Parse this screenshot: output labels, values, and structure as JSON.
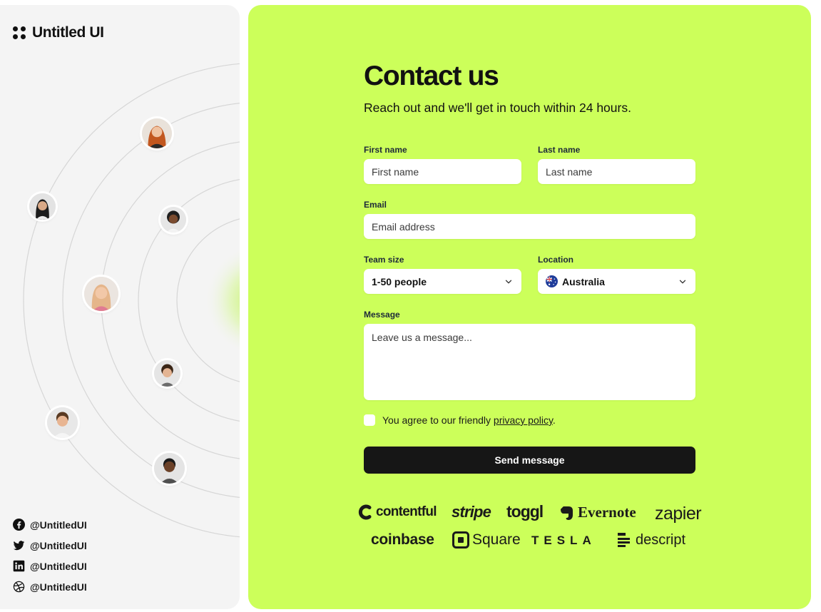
{
  "brand": {
    "name": "Untitled UI"
  },
  "socials": [
    {
      "icon": "facebook-icon",
      "handle": "@UntitledUI"
    },
    {
      "icon": "twitter-icon",
      "handle": "@UntitledUI"
    },
    {
      "icon": "linkedin-icon",
      "handle": "@UntitledUI"
    },
    {
      "icon": "dribbble-icon",
      "handle": "@UntitledUI"
    }
  ],
  "form": {
    "title": "Contact us",
    "subtitle": "Reach out and we'll get in touch within 24 hours.",
    "first_name": {
      "label": "First name",
      "placeholder": "First name"
    },
    "last_name": {
      "label": "Last name",
      "placeholder": "Last name"
    },
    "email": {
      "label": "Email",
      "placeholder": "Email address"
    },
    "team_size": {
      "label": "Team size",
      "value": "1-50 people"
    },
    "location": {
      "label": "Location",
      "value": "Australia",
      "flag_icon": "australia-flag-icon"
    },
    "message": {
      "label": "Message",
      "placeholder": "Leave us a message..."
    },
    "agree": {
      "prefix": "You agree to our friendly ",
      "link": "privacy policy",
      "suffix": "."
    },
    "submit_label": "Send message"
  },
  "logos": [
    "contentful",
    "stripe",
    "toggl",
    "Evernote",
    "zapier",
    "coinbase",
    "Square",
    "TESLA",
    "descript"
  ],
  "colors": {
    "accent": "#ccff5a",
    "button": "#161616",
    "panel": "#f4f4f4"
  }
}
